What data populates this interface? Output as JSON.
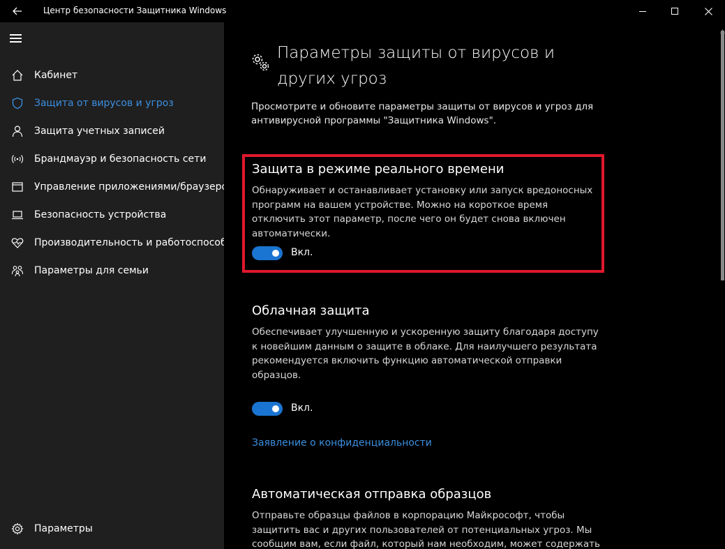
{
  "window": {
    "title": "Центр безопасности Защитника Windows"
  },
  "sidebar": {
    "items": [
      {
        "label": "Кабинет",
        "icon": "home-icon"
      },
      {
        "label": "Защита от вирусов и угроз",
        "icon": "shield-icon",
        "active": true
      },
      {
        "label": "Защита учетных записей",
        "icon": "person-icon"
      },
      {
        "label": "Брандмауэр и безопасность сети",
        "icon": "wifi-icon"
      },
      {
        "label": "Управление приложениями/браузером",
        "icon": "window-icon"
      },
      {
        "label": "Безопасность устройства",
        "icon": "laptop-icon"
      },
      {
        "label": "Производительность и работоспособность",
        "icon": "heart-icon"
      },
      {
        "label": "Параметры для семьи",
        "icon": "family-icon"
      }
    ],
    "settings_label": "Параметры"
  },
  "main": {
    "title": "Параметры защиты от вирусов и других угроз",
    "description": "Просмотрите и обновите параметры защиты от вирусов и угроз для антивирусной программы \"Защитника Windows\".",
    "sections": [
      {
        "title": "Защита в режиме реального времени",
        "description": "Обнаруживает и останавливает установку или запуск вредоносных программ на вашем устройстве. Можно на короткое время отключить этот параметр, после чего он будет снова включен автоматически.",
        "toggle_label": "Вкл.",
        "toggle_on": true
      },
      {
        "title": "Облачная защита",
        "description": "Обеспечивает улучшенную и ускоренную защиту благодаря доступу к новейшим данным о защите в облаке. Для наилучшего результата рекомендуется включить функцию автоматической отправки образцов.",
        "toggle_label": "Вкл.",
        "toggle_on": true
      },
      {
        "title": "Автоматическая отправка образцов",
        "description": "Отправьте образцы файлов в корпорацию Майкрософт, чтобы защитить вас и других пользователей от потенциальных угроз. Мы сообщим вам, если файл, который нам необходим, может содержать"
      }
    ],
    "privacy_link": "Заявление о конфиденциальности"
  },
  "colors": {
    "accent": "#1a74d1",
    "link": "#3b8fe0",
    "highlight": "#e0182d",
    "sidebar_bg": "#1f1f1f",
    "main_bg": "#000000"
  }
}
